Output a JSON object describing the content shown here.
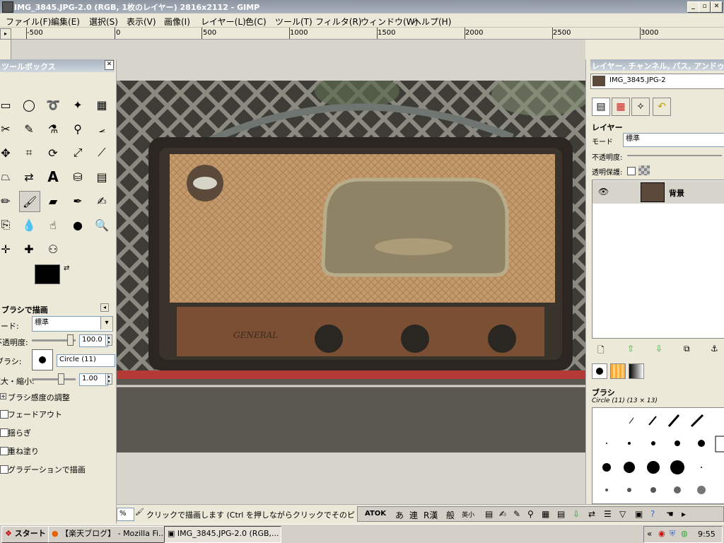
{
  "window": {
    "title": "IMG_3845.JPG-2.0 (RGB, 1枚のレイヤー) 2816x2112 - GIMP",
    "min": "_",
    "max": "▫",
    "close": "✕"
  },
  "menu": [
    "ファイル(F)",
    "編集(E)",
    "選択(S)",
    "表示(V)",
    "画像(I)",
    "レイヤー(L)",
    "色(C)",
    "ツール(T)",
    "フィルタ(R)",
    "ウィンドウ(W)",
    "ヘルプ(H)"
  ],
  "ruler": {
    "labels": [
      "-500",
      "0",
      "500",
      "1000",
      "1500",
      "2000",
      "2500",
      "3000"
    ]
  },
  "toolbox": {
    "title": "ツールボックス",
    "close": "✕",
    "options_title": "ブラシで描画",
    "mode_label": "モード:",
    "mode_value": "標準",
    "opacity_label": "不透明度:",
    "opacity_value": "100.0",
    "brush_label": "ブラシ:",
    "brush_value": "Circle (11)",
    "scale_label": "拡大・縮小:",
    "scale_value": "1.00",
    "pressure": "ブラシ感度の調整",
    "options": [
      "フェードアウト",
      "揺らぎ",
      "重ね塗り",
      "グラデーションで描画"
    ]
  },
  "dock": {
    "title": "レイヤー, チャンネル, パス, アンドゥ",
    "image_name": "IMG_3845.JPG-2",
    "layers_label": "レイヤー",
    "mode_label": "モード",
    "mode_value": "標準",
    "opacity_label": "不透明度:",
    "lock_label": "透明保護:",
    "layer_name": "背景",
    "brushes_label": "ブラシ",
    "brush_info": "Circle (11) (13 × 13)"
  },
  "status": {
    "zoom": "%",
    "message": "クリックで描画します (Ctrl を押しながらクリックでそのピクセルの色",
    "ime": [
      "ATOK",
      "あ",
      "連",
      "R漢",
      "般",
      "英小"
    ]
  },
  "taskbar": {
    "start": "スタート",
    "items": [
      "【楽天ブログ】 - Mozilla Fi...",
      "IMG_3845.JPG-2.0 (RGB,..."
    ],
    "clock": "9:55",
    "tray_arrows": "«"
  }
}
